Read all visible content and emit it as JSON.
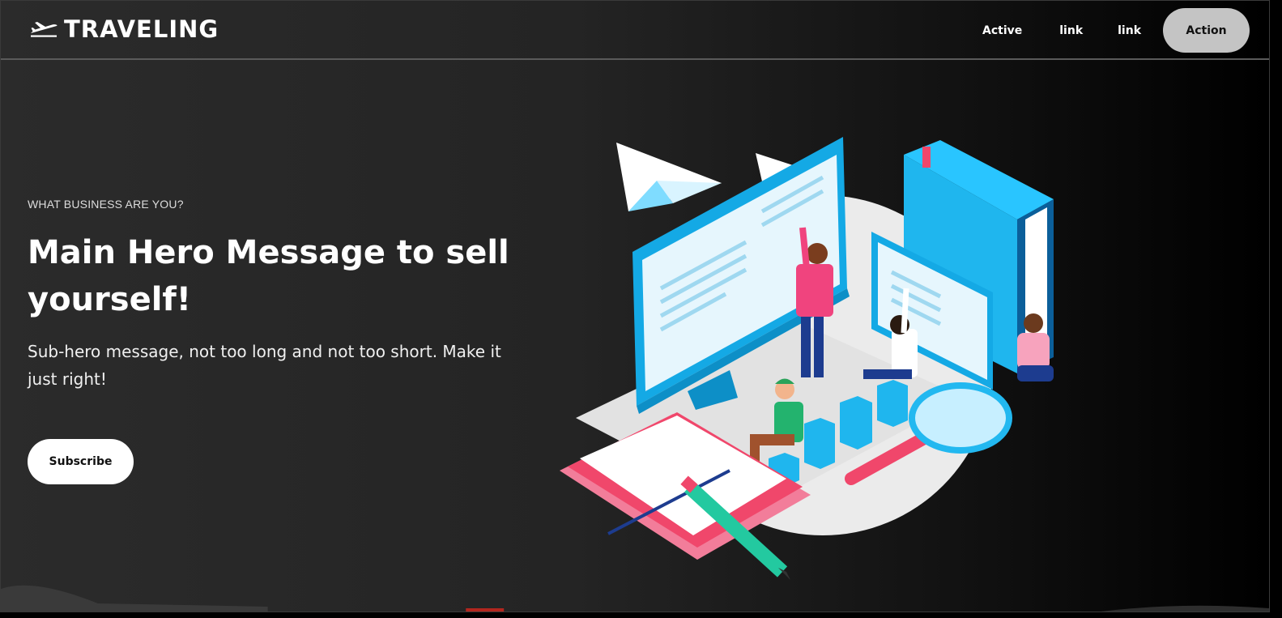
{
  "brand": {
    "name": "TRAVELING",
    "icon": "airplane-icon"
  },
  "nav": {
    "links": [
      "Active",
      "link",
      "link"
    ],
    "action_label": "Action"
  },
  "hero": {
    "eyebrow": "WHAT BUSINESS ARE YOU?",
    "title": "Main Hero Message to sell yourself!",
    "subtitle": "Sub-hero message, not too long and not too short. Make it just right!",
    "cta_label": "Subscribe"
  },
  "colors": {
    "background_dark": "#242424",
    "action_button": "#c4c4c4",
    "accent_blue": "#1fb6ee",
    "accent_pink": "#f0476b"
  }
}
